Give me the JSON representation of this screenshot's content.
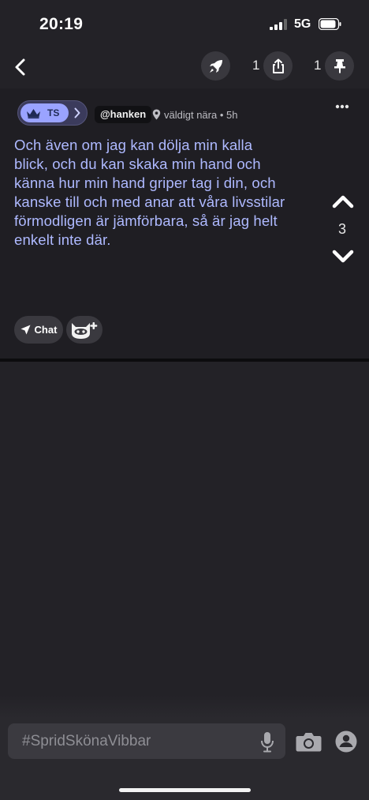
{
  "status_bar": {
    "time": "20:19",
    "network": "5G",
    "icons": [
      "signal-icon",
      "battery-icon"
    ]
  },
  "nav": {
    "icons": [
      "back-chevron-icon",
      "rocket-icon",
      "share-icon",
      "pin-icon"
    ],
    "share_count": "1",
    "pin_count": "1"
  },
  "post": {
    "badge_label": "TS",
    "username": "@hanken",
    "location": "väldigt nära",
    "time": "• 5h",
    "text": "Och även om jag kan dölja min kalla blick, och du kan skaka min hand och känna hur min hand griper tag i din, och kanske till och med anar att våra livsstilar förmodligen är jämförbara, så är jag helt enkelt inte där.",
    "votes": "3",
    "chat_label": "Chat",
    "text_color": "#aeb9ff",
    "badge_color": "#9aa3ff"
  },
  "composer": {
    "placeholder": "#SpridSkönaVibbar"
  }
}
